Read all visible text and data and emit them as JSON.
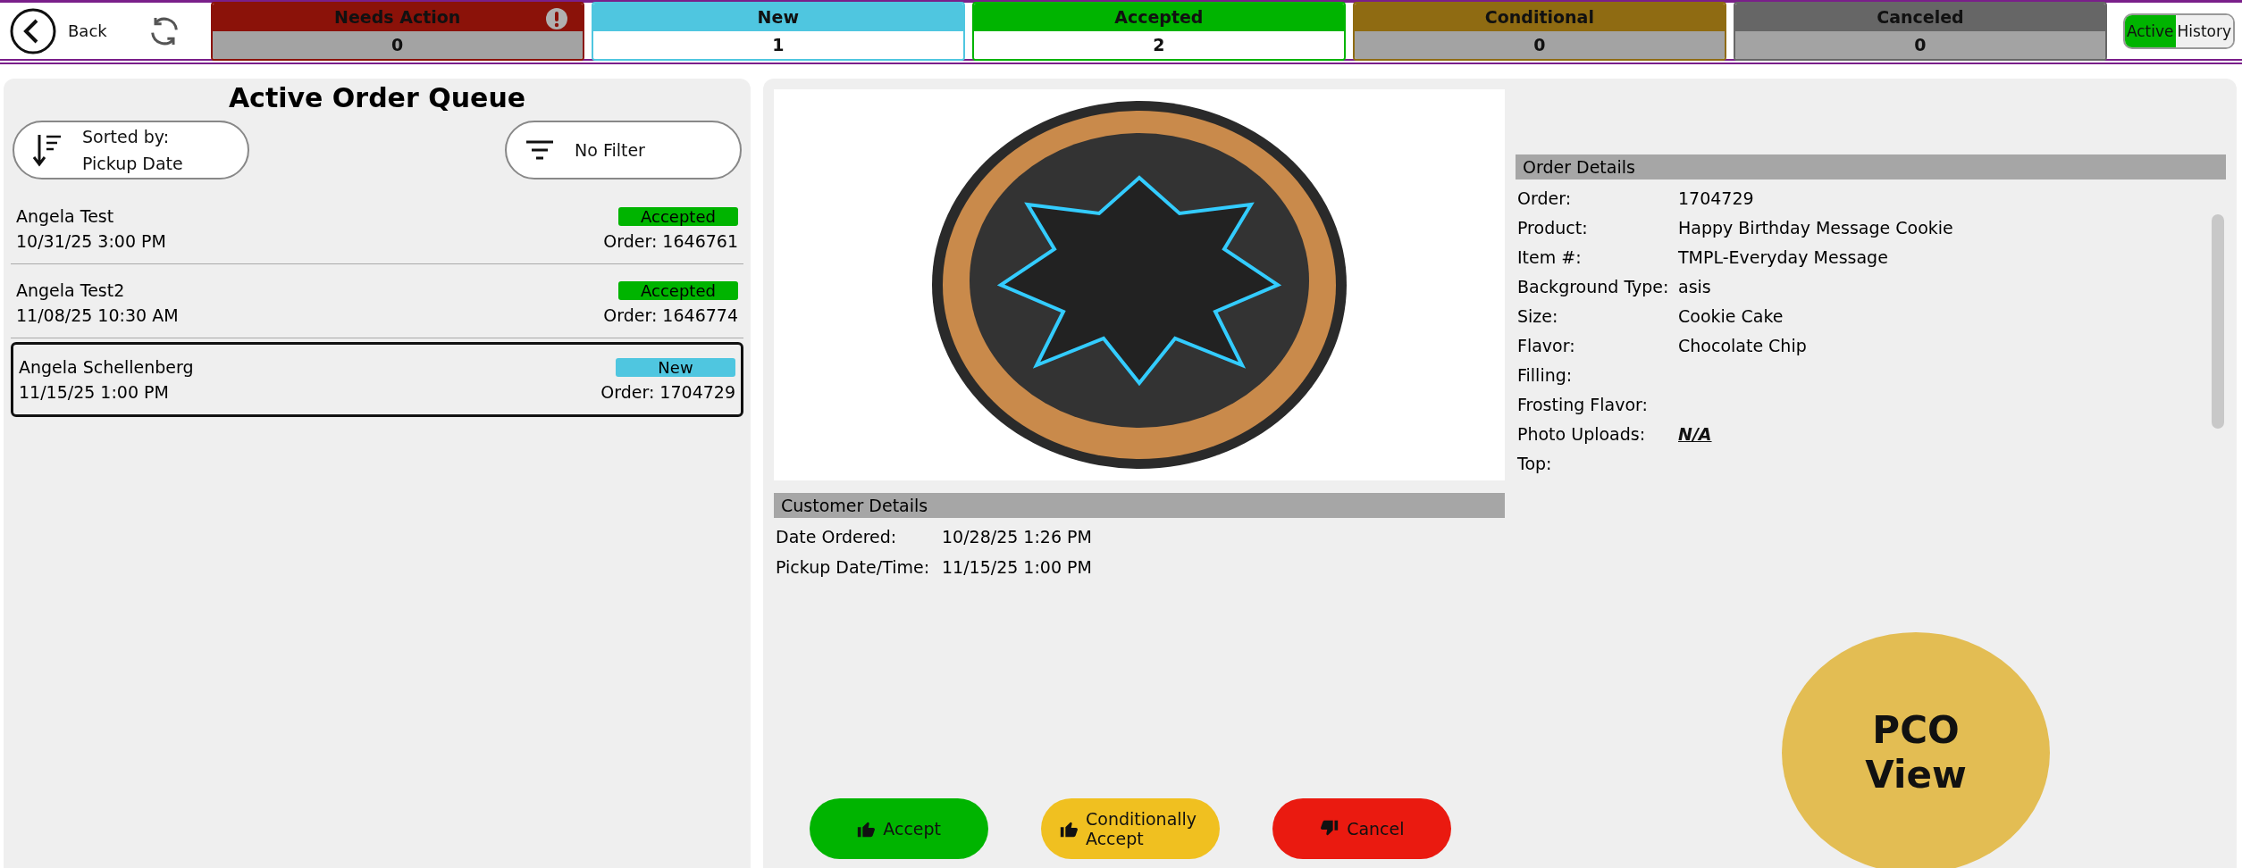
{
  "header": {
    "back_label": "Back"
  },
  "status_tiles": [
    {
      "label": "Needs Action",
      "count": "0",
      "color": "#8b1209",
      "highlighted": false,
      "alert": true
    },
    {
      "label": "New",
      "count": "1",
      "color": "#4fc6e0",
      "highlighted": true,
      "alert": false
    },
    {
      "label": "Accepted",
      "count": "2",
      "color": "#00b400",
      "highlighted": true,
      "alert": false
    },
    {
      "label": "Conditional",
      "count": "0",
      "color": "#8f6b12",
      "highlighted": false,
      "alert": false
    },
    {
      "label": "Canceled",
      "count": "0",
      "color": "#666666",
      "highlighted": false,
      "alert": false
    }
  ],
  "view_toggle": [
    {
      "label": "Active",
      "selected": true
    },
    {
      "label": "History",
      "selected": false
    }
  ],
  "queue": {
    "title": "Active Order Queue",
    "sort_label": "Sorted by:",
    "sort_value": "Pickup Date",
    "filter_label": "No Filter",
    "orders": [
      {
        "name": "Angela Test",
        "pickup": "10/31/25 3:00 PM",
        "status": "Accepted",
        "color": "#00b400",
        "order": "Order: 1646761",
        "selected": false
      },
      {
        "name": "Angela Test2",
        "pickup": "11/08/25 10:30 AM",
        "status": "Accepted",
        "color": "#00b400",
        "order": "Order: 1646774",
        "selected": false
      },
      {
        "name": "Angela Schellenberg",
        "pickup": "11/15/25 1:00 PM",
        "status": "New",
        "color": "#4fc6e0",
        "order": "Order: 1704729",
        "selected": true
      }
    ]
  },
  "customer_details": {
    "title": "Customer Details",
    "rows": [
      {
        "label": "Date Ordered:",
        "value": "10/28/25 1:26 PM"
      },
      {
        "label": "Pickup Date/Time:",
        "value": "11/15/25 1:00 PM"
      }
    ]
  },
  "order_details": {
    "title": "Order Details",
    "rows": [
      {
        "label": "Order:",
        "value": "1704729",
        "kind": "text"
      },
      {
        "label": "Product:",
        "value": "Happy Birthday Message Cookie",
        "kind": "text"
      },
      {
        "label": "Item #:",
        "value": "TMPL-Everyday Message",
        "kind": "text"
      },
      {
        "label": "Background Type:",
        "value": "asis",
        "kind": "text"
      },
      {
        "label": "Size:",
        "value": "Cookie Cake",
        "kind": "text"
      },
      {
        "label": "Flavor:",
        "value": "Chocolate Chip",
        "kind": "text"
      },
      {
        "label": "Filling:"
      },
      {
        "label": "Frosting Flavor:"
      },
      {
        "label": "Photo Uploads:",
        "value": "N/A",
        "kind": "link"
      },
      {
        "label": "Top:"
      }
    ]
  },
  "actions": [
    {
      "label": "Accept",
      "kind": "accept"
    },
    {
      "label": "Conditionally Accept",
      "kind": "conditional"
    },
    {
      "label": "Cancel",
      "kind": "cancel"
    }
  ],
  "overlay": {
    "label": "PCO View"
  }
}
